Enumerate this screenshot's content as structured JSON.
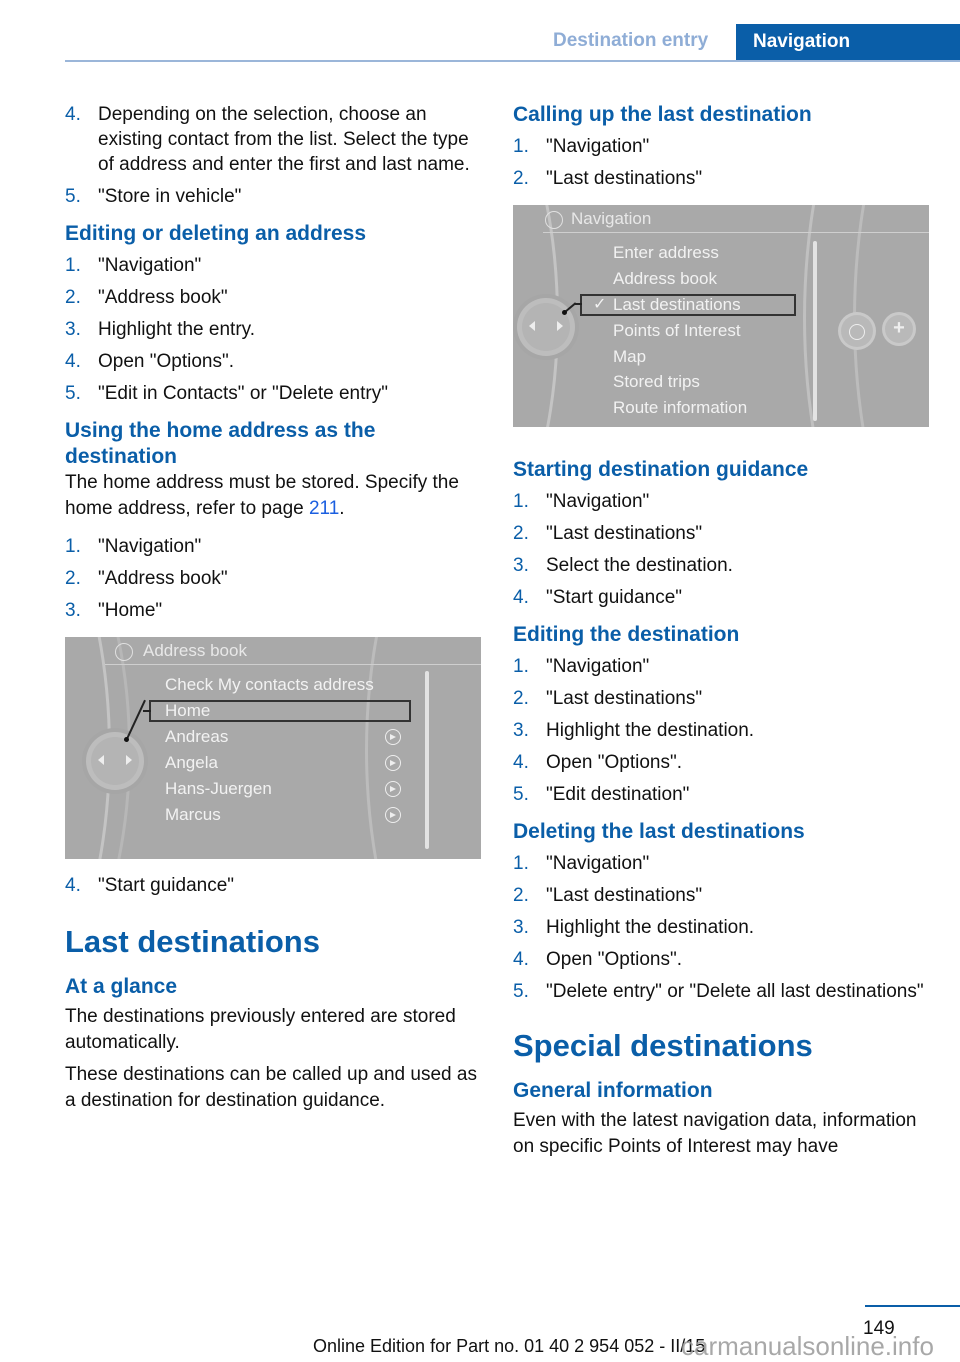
{
  "header": {
    "section": "Destination entry",
    "chapter": "Navigation"
  },
  "left": {
    "continued_steps": [
      {
        "num": "4.",
        "text": "Depending on the selection, choose an existing contact from the list. Select the type of address and enter the first and last name."
      },
      {
        "num": "5.",
        "text": "\"Store in vehicle\""
      }
    ],
    "editing": {
      "heading": "Editing or deleting an address",
      "steps": [
        {
          "num": "1.",
          "text": "\"Navigation\""
        },
        {
          "num": "2.",
          "text": "\"Address book\""
        },
        {
          "num": "3.",
          "text": "Highlight the entry."
        },
        {
          "num": "4.",
          "text": "Open \"Options\"."
        },
        {
          "num": "5.",
          "text": "\"Edit in Contacts\" or \"Delete entry\""
        }
      ]
    },
    "home": {
      "heading": "Using the home address as the destination",
      "intro_before": "The home address must be stored. Specify the home address, refer to page ",
      "page_ref": "211",
      "intro_after": ".",
      "steps": [
        {
          "num": "1.",
          "text": "\"Navigation\""
        },
        {
          "num": "2.",
          "text": "\"Address book\""
        },
        {
          "num": "3.",
          "text": "\"Home\""
        }
      ],
      "screen": {
        "title": "Address book",
        "items": [
          "Check My contacts address",
          "Home",
          "Andreas",
          "Angela",
          "Hans-Juergen",
          "Marcus"
        ],
        "selected": "Home"
      },
      "after_steps": [
        {
          "num": "4.",
          "text": "\"Start guidance\""
        }
      ]
    },
    "last_destinations": {
      "heading": "Last destinations",
      "subheading": "At a glance",
      "para1": "The destinations previously entered are stored automatically.",
      "para2": "These destinations can be called up and used as a destination for destination guidance."
    }
  },
  "right": {
    "calling": {
      "heading": "Calling up the last destination",
      "steps": [
        {
          "num": "1.",
          "text": "\"Navigation\""
        },
        {
          "num": "2.",
          "text": "\"Last destinations\""
        }
      ],
      "screen": {
        "title": "Navigation",
        "items": [
          "Enter address",
          "Address book",
          "Last destinations",
          "Points of Interest",
          "Map",
          "Stored trips",
          "Route information"
        ],
        "selected": "Last destinations",
        "check_glyph": "✓",
        "plus_glyph": "+"
      }
    },
    "starting": {
      "heading": "Starting destination guidance",
      "steps": [
        {
          "num": "1.",
          "text": "\"Navigation\""
        },
        {
          "num": "2.",
          "text": "\"Last destinations\""
        },
        {
          "num": "3.",
          "text": "Select the destination."
        },
        {
          "num": "4.",
          "text": "\"Start guidance\""
        }
      ]
    },
    "editing": {
      "heading": "Editing the destination",
      "steps": [
        {
          "num": "1.",
          "text": "\"Navigation\""
        },
        {
          "num": "2.",
          "text": "\"Last destinations\""
        },
        {
          "num": "3.",
          "text": "Highlight the destination."
        },
        {
          "num": "4.",
          "text": "Open \"Options\"."
        },
        {
          "num": "5.",
          "text": "\"Edit destination\""
        }
      ]
    },
    "deleting": {
      "heading": "Deleting the last destinations",
      "steps": [
        {
          "num": "1.",
          "text": "\"Navigation\""
        },
        {
          "num": "2.",
          "text": "\"Last destinations\""
        },
        {
          "num": "3.",
          "text": "Highlight the destination."
        },
        {
          "num": "4.",
          "text": "Open \"Options\"."
        },
        {
          "num": "5.",
          "text": "\"Delete entry\" or \"Delete all last destinations\""
        }
      ]
    },
    "special": {
      "heading": "Special destinations",
      "subheading": "General information",
      "para": "Even with the latest navigation data, information on specific Points of Interest may have"
    }
  },
  "footer": {
    "page_number": "149",
    "edition": "Online Edition for Part no. 01 40 2 954 052 - II/15",
    "watermark": "carmanualsonline.info"
  }
}
